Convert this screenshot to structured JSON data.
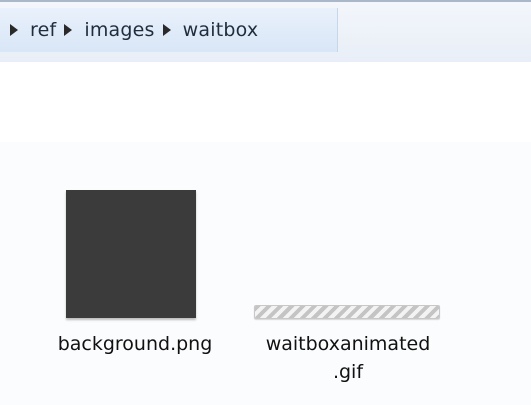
{
  "breadcrumb": {
    "items": [
      {
        "label": "ref"
      },
      {
        "label": "images"
      },
      {
        "label": "waitbox"
      }
    ]
  },
  "files": [
    {
      "name": "background.png",
      "icon": "image-thumbnail"
    },
    {
      "name_line1": "waitboxanimated",
      "name_line2": ".gif",
      "icon": "gif-thumbnail"
    }
  ]
}
